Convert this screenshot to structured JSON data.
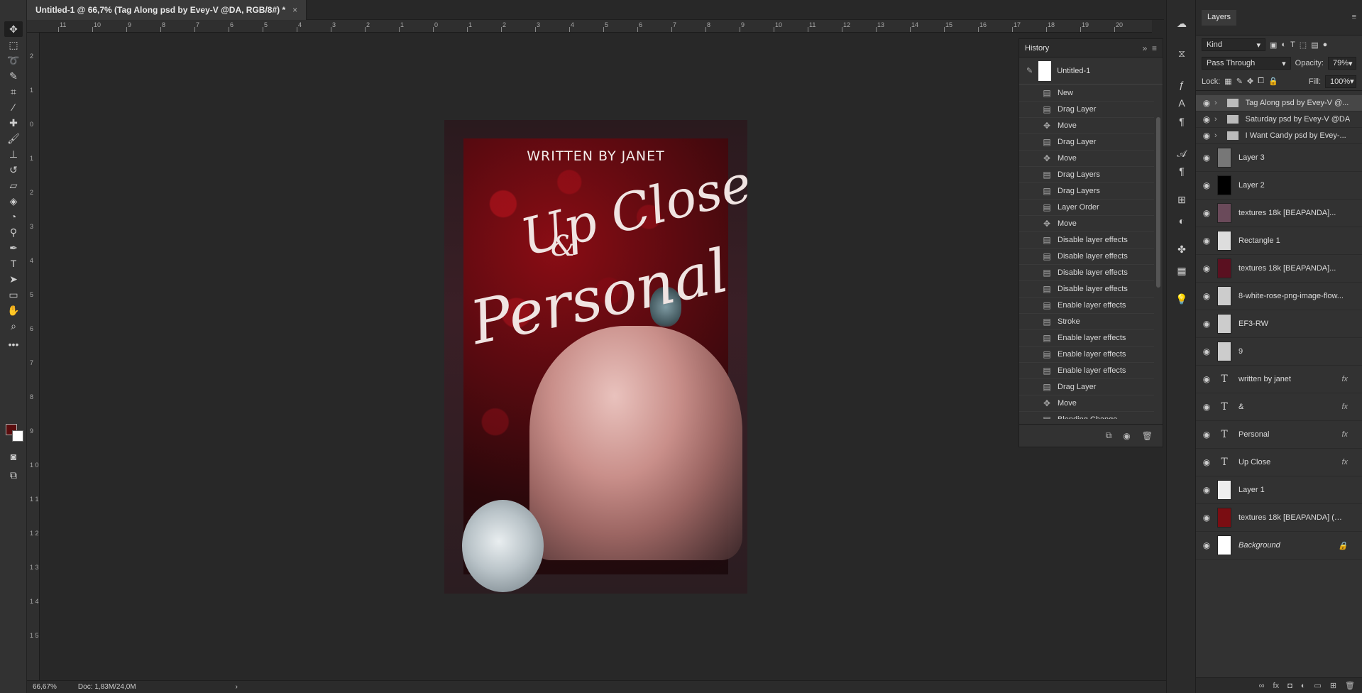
{
  "document": {
    "tab_title": "Untitled-1 @ 66,7% (Tag Along psd by Evey-V @DA, RGB/8#) *",
    "close_glyph": "×"
  },
  "rulers": {
    "top_labels": [
      "11",
      "10",
      "9",
      "8",
      "7",
      "6",
      "5",
      "4",
      "3",
      "2",
      "1",
      "0",
      "1",
      "2",
      "3",
      "4",
      "5",
      "6",
      "7",
      "8",
      "9",
      "10",
      "11",
      "12",
      "13",
      "14",
      "15",
      "16",
      "17",
      "18",
      "19",
      "20"
    ],
    "left_labels": [
      "2",
      "1",
      "0",
      "1",
      "2",
      "3",
      "4",
      "5",
      "6",
      "7",
      "8",
      "9",
      "1 0",
      "1 1",
      "1 2",
      "1 3",
      "1 4",
      "1 5"
    ]
  },
  "poster": {
    "written_by": "WRITTEN BY JANET",
    "up_close": "Up Close",
    "amp": "&",
    "personal": "Personal"
  },
  "history": {
    "title": "History",
    "snapshot": "Untitled-1",
    "items": [
      {
        "icon": "doc",
        "label": "New"
      },
      {
        "icon": "doc",
        "label": "Drag Layer"
      },
      {
        "icon": "move",
        "label": "Move"
      },
      {
        "icon": "doc",
        "label": "Drag Layer"
      },
      {
        "icon": "move",
        "label": "Move"
      },
      {
        "icon": "doc",
        "label": "Drag Layers"
      },
      {
        "icon": "doc",
        "label": "Drag Layers"
      },
      {
        "icon": "doc",
        "label": "Layer Order"
      },
      {
        "icon": "move",
        "label": "Move"
      },
      {
        "icon": "doc",
        "label": "Disable layer effects"
      },
      {
        "icon": "doc",
        "label": "Disable layer effects"
      },
      {
        "icon": "doc",
        "label": "Disable layer effects"
      },
      {
        "icon": "doc",
        "label": "Disable layer effects"
      },
      {
        "icon": "doc",
        "label": "Enable layer effects"
      },
      {
        "icon": "doc",
        "label": "Stroke"
      },
      {
        "icon": "doc",
        "label": "Enable layer effects"
      },
      {
        "icon": "doc",
        "label": "Enable layer effects"
      },
      {
        "icon": "doc",
        "label": "Enable layer effects"
      },
      {
        "icon": "doc",
        "label": "Drag Layer"
      },
      {
        "icon": "move",
        "label": "Move"
      },
      {
        "icon": "doc",
        "label": "Blending Change"
      }
    ]
  },
  "layers": {
    "tab": "Layers",
    "filter": "Kind",
    "blend_mode": "Pass Through",
    "opacity_label": "Opacity:",
    "opacity": "79%",
    "lock_label": "Lock:",
    "fill_label": "Fill:",
    "fill": "100%",
    "items": [
      {
        "type": "group",
        "name": "Tag Along psd by Evey-V @...",
        "selected": true
      },
      {
        "type": "group",
        "name": "Saturday psd by Evey-V @DA"
      },
      {
        "type": "group",
        "name": "I Want Candy psd by Evey-..."
      },
      {
        "type": "pixel",
        "name": "Layer 3",
        "thumb": "#777"
      },
      {
        "type": "pixel",
        "name": "Layer 2",
        "thumb": "#000"
      },
      {
        "type": "pixel",
        "name": "textures 18k [BEAPANDA]...",
        "thumb": "#6a4a5a"
      },
      {
        "type": "pixel",
        "name": "Rectangle 1",
        "thumb": "#ddd"
      },
      {
        "type": "pixel",
        "name": "textures 18k [BEAPANDA]...",
        "thumb": "#5a1020"
      },
      {
        "type": "pixel",
        "name": "8-white-rose-png-image-flow...",
        "thumb": "#ccc"
      },
      {
        "type": "pixel",
        "name": "EF3-RW",
        "thumb": "#ccc"
      },
      {
        "type": "pixel",
        "name": "9",
        "thumb": "#ccc"
      },
      {
        "type": "text",
        "name": "written by janet",
        "fx": "fx"
      },
      {
        "type": "text",
        "name": "&",
        "fx": "fx"
      },
      {
        "type": "text",
        "name": "Personal",
        "fx": "fx"
      },
      {
        "type": "text",
        "name": "Up Close",
        "fx": "fx"
      },
      {
        "type": "pixel",
        "name": "Layer 1",
        "thumb": "#eee"
      },
      {
        "type": "pixel",
        "name": "textures 18k [BEAPANDA] (2...",
        "thumb": "#7a0d12"
      },
      {
        "type": "pixel",
        "name": "Background",
        "thumb": "#fff",
        "locked": true
      }
    ]
  },
  "status": {
    "zoom": "66,67%",
    "doc": "Doc: 1,83M/24,0M"
  },
  "colors": {
    "foreground": "#5a0d0e",
    "background": "#ffffff"
  }
}
